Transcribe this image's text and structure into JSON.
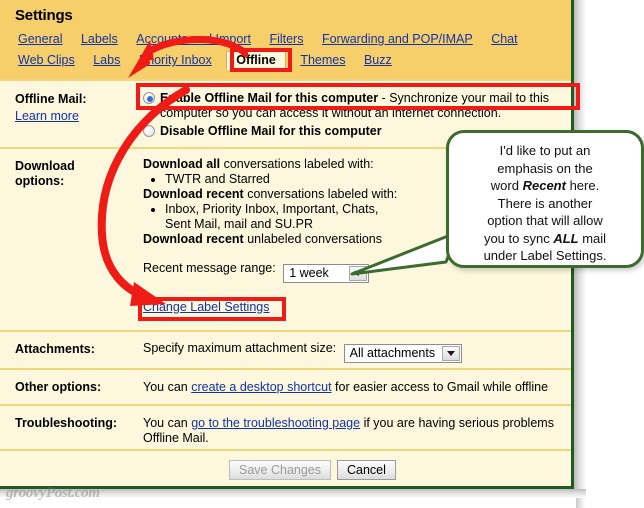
{
  "window": {
    "title": "Settings",
    "watermark": "groovyPost.com",
    "colors": {
      "header_bg": "#f6cf6a",
      "body_bg": "#fdf8dd",
      "divider": "#f3d67a",
      "link": "#1133aa",
      "annotation_red": "#ee1b16",
      "callout_green": "#3c6b2e",
      "page_border": "#1d5c1d"
    }
  },
  "tabs": {
    "row1": [
      {
        "label": "General",
        "active": false
      },
      {
        "label": "Labels",
        "active": false
      },
      {
        "label": "Accounts and Import",
        "active": false
      },
      {
        "label": "Filters",
        "active": false
      },
      {
        "label": "Forwarding and POP/IMAP",
        "active": false
      },
      {
        "label": "Chat",
        "active": false
      }
    ],
    "row2": [
      {
        "label": "Web Clips",
        "active": false
      },
      {
        "label": "Labs",
        "active": false
      },
      {
        "label": "Priority Inbox",
        "active": false
      },
      {
        "label": "Offline",
        "active": true
      },
      {
        "label": "Themes",
        "active": false
      },
      {
        "label": "Buzz",
        "active": false
      }
    ]
  },
  "sections": {
    "offline_mail": {
      "label": "Offline Mail:",
      "sublink": "Learn more",
      "radio_enable": {
        "label_bold": "Enable Offline Mail for this computer",
        "label_rest": " - Synchronize your mail to this",
        "line2": "computer so you can access it without an internet connection.",
        "selected": true
      },
      "radio_disable": {
        "label_bold": "Disable Offline Mail for this computer",
        "selected": false
      }
    },
    "download_options": {
      "label_line1": "Download",
      "label_line2": "options:",
      "download_all_bold": "Download all",
      "download_all_rest": " conversations labeled with:",
      "download_all_items": [
        "TWTR and Starred"
      ],
      "download_recent_bold": "Download recent",
      "download_recent_rest": " conversations labeled with:",
      "download_recent_items": [
        "Inbox, Priority Inbox, Important, Chats, Sent Mail, mail and SU.PR"
      ],
      "download_unlabeled_bold": "Download recent",
      "download_unlabeled_rest": " unlabeled conversations",
      "range_label": "Recent message range:",
      "range_value": "1 week",
      "change_label_link": "Change Label Settings"
    },
    "attachments": {
      "label": "Attachments:",
      "text": "Specify maximum attachment size:",
      "select_value": "All attachments"
    },
    "other_options": {
      "label": "Other options:",
      "text_before": "You can ",
      "link": "create a desktop shortcut",
      "text_after": " for easier access to Gmail while offline"
    },
    "troubleshooting": {
      "label": "Troubleshooting:",
      "text_before": "You can ",
      "link": "go to the troubleshooting page",
      "text_after": " if you are having serious problems",
      "line2": "Offline Mail."
    }
  },
  "buttons": {
    "save": "Save Changes",
    "cancel": "Cancel"
  },
  "callout": {
    "line1": "I'd like to put an",
    "line2": "emphasis on the",
    "line3_before": "word ",
    "line3_em": "Recent",
    "line3_after": " here.",
    "line4": "There is another",
    "line5": "option that will allow",
    "line6_before": "you to sync ",
    "line6_em": "ALL",
    "line6_after": " mail",
    "line7": "under Label Settings."
  }
}
